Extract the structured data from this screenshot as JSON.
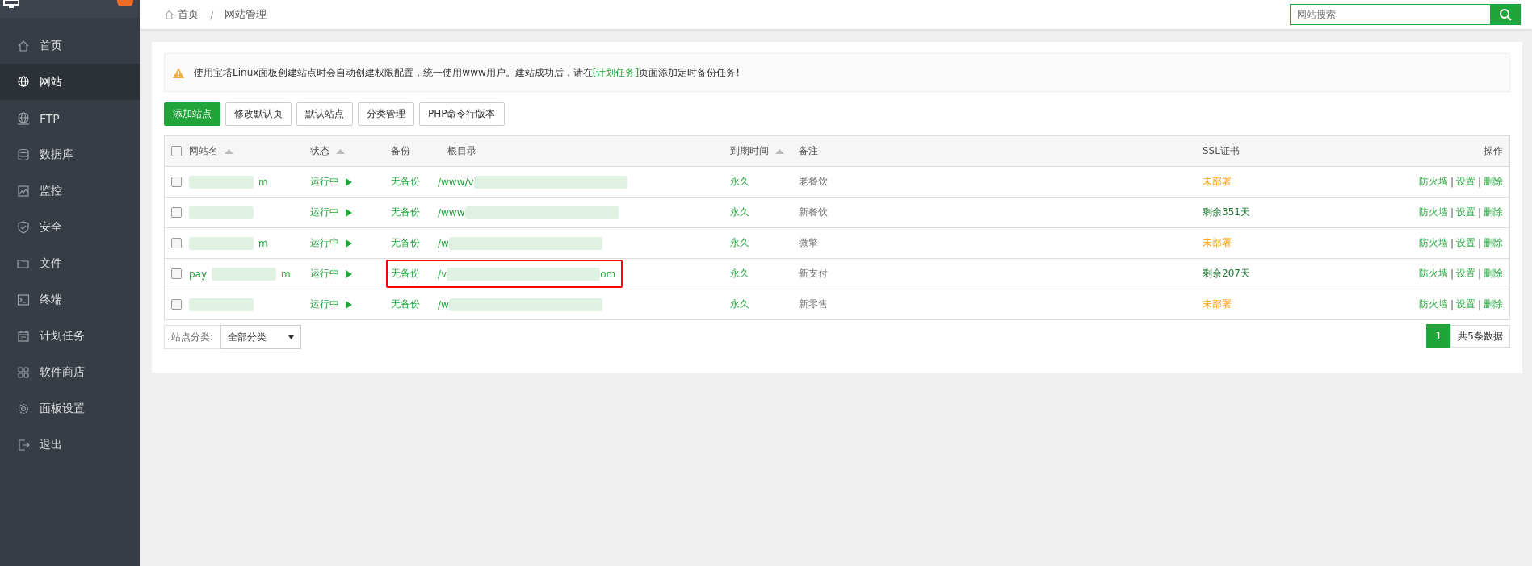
{
  "sidebar": {
    "items": [
      {
        "label": "首页",
        "selected": false
      },
      {
        "label": "网站",
        "selected": true
      },
      {
        "label": "FTP",
        "selected": false
      },
      {
        "label": "数据库",
        "selected": false
      },
      {
        "label": "监控",
        "selected": false
      },
      {
        "label": "安全",
        "selected": false
      },
      {
        "label": "文件",
        "selected": false
      },
      {
        "label": "终端",
        "selected": false
      },
      {
        "label": "计划任务",
        "selected": false
      },
      {
        "label": "软件商店",
        "selected": false
      },
      {
        "label": "面板设置",
        "selected": false
      },
      {
        "label": "退出",
        "selected": false
      }
    ]
  },
  "breadcrumb": [
    {
      "label": "首页"
    },
    {
      "separator": "/",
      "label": "网站管理"
    }
  ],
  "search": {
    "placeholder": "网站搜索"
  },
  "notice": {
    "before": "使用宝塔Linux面板创建站点时会自动创建权限配置，统一使用www用户。建站成功后，请在",
    "link": "[计划任务]",
    "after": "页面添加定时备份任务!"
  },
  "toolbar": [
    {
      "label": "添加站点",
      "kind": "primary"
    },
    {
      "label": "修改默认页",
      "kind": "default"
    },
    {
      "label": "默认站点",
      "kind": "default"
    },
    {
      "label": "分类管理",
      "kind": "default"
    },
    {
      "label": "PHP命令行版本",
      "kind": "default"
    }
  ],
  "table": {
    "header_checked": false,
    "columns": [
      {
        "label": "网站名",
        "sort_arrow": true
      },
      {
        "label": "状态",
        "sort_arrow": true
      },
      {
        "label": "备份",
        "sort_arrow": false
      },
      {
        "label": "根目录",
        "sort_arrow": false
      },
      {
        "label": "到期时间",
        "sort_arrow": true
      },
      {
        "label": "备注",
        "sort_arrow": false
      },
      {
        "label": "SSL证书",
        "sort_arrow": false
      },
      {
        "label": "操作",
        "sort_arrow": false
      }
    ],
    "rows": [
      {
        "checked": false,
        "name_end": "m",
        "status": "运行中",
        "backup": "无备份",
        "path_start": "/www/v",
        "expiry": "永久",
        "remark": "老餐饮",
        "ssl": {
          "text": "未部署",
          "kind": "none"
        },
        "actions": [
          {
            "label": "防火墙"
          },
          {
            "separator": "|",
            "label": "设置"
          },
          {
            "separator": "|",
            "label": "删除"
          }
        ],
        "highlighted": false
      },
      {
        "checked": false,
        "status": "运行中",
        "backup": "无备份",
        "path_start": "/www",
        "expiry": "永久",
        "remark": "新餐饮",
        "ssl": {
          "text": "剩余351天",
          "kind": "active"
        },
        "actions": [
          {
            "label": "防火墙"
          },
          {
            "separator": "|",
            "label": "设置"
          },
          {
            "separator": "|",
            "label": "删除"
          }
        ],
        "highlighted": false
      },
      {
        "checked": false,
        "name_end": "m",
        "status": "运行中",
        "backup": "无备份",
        "path_start": "/w",
        "expiry": "永久",
        "remark": "微擎",
        "ssl": {
          "text": "未部署",
          "kind": "none"
        },
        "actions": [
          {
            "label": "防火墙"
          },
          {
            "separator": "|",
            "label": "设置"
          },
          {
            "separator": "|",
            "label": "删除"
          }
        ],
        "highlighted": false
      },
      {
        "checked": false,
        "name_start": "pay",
        "name_end": "m",
        "status": "运行中",
        "backup": "无备份",
        "path_start": "/v",
        "path_end": "om",
        "expiry": "永久",
        "remark": "新支付",
        "ssl": {
          "text": "剩余207天",
          "kind": "active"
        },
        "actions": [
          {
            "label": "防火墙"
          },
          {
            "separator": "|",
            "label": "设置"
          },
          {
            "separator": "|",
            "label": "删除"
          }
        ],
        "highlighted": true
      },
      {
        "checked": false,
        "status": "运行中",
        "backup": "无备份",
        "path_start": "/w",
        "expiry": "永久",
        "remark": "新零售",
        "ssl": {
          "text": "未部署",
          "kind": "none"
        },
        "actions": [
          {
            "label": "防火墙"
          },
          {
            "separator": "|",
            "label": "设置"
          },
          {
            "separator": "|",
            "label": "删除"
          }
        ],
        "highlighted": false
      }
    ]
  },
  "category": {
    "label": "站点分类:",
    "value": "全部分类"
  },
  "pagination": {
    "pages": [
      {
        "label": "1",
        "selected": true
      }
    ],
    "total": "共5条数据"
  }
}
